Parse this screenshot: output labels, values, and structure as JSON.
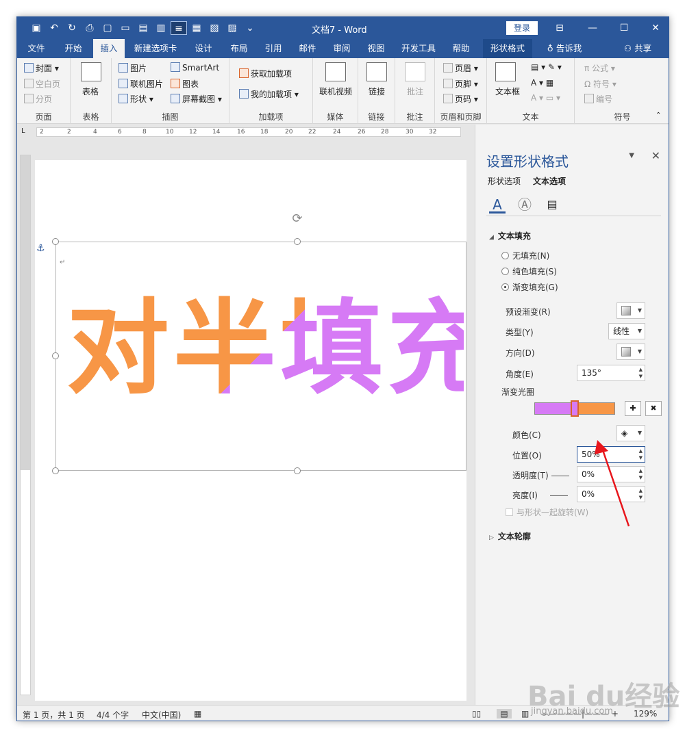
{
  "window": {
    "title": "文档7 - Word",
    "login_label": "登录",
    "controls": [
      "ribbon-display-icon",
      "minimize-icon",
      "maximize-icon",
      "close-icon"
    ]
  },
  "tabs": [
    {
      "label": "文件"
    },
    {
      "label": "开始"
    },
    {
      "label": "插入"
    },
    {
      "label": "新建选项卡"
    },
    {
      "label": "设计"
    },
    {
      "label": "布局"
    },
    {
      "label": "引用"
    },
    {
      "label": "邮件"
    },
    {
      "label": "审阅"
    },
    {
      "label": "视图"
    },
    {
      "label": "开发工具"
    },
    {
      "label": "帮助"
    },
    {
      "label": "形状格式"
    },
    {
      "label": "告诉我"
    },
    {
      "label": "共享"
    }
  ],
  "ribbon": {
    "pages": {
      "label": "页面",
      "cover": "封面",
      "blank": "空白页",
      "break": "分页"
    },
    "table": {
      "label": "表格",
      "btn": "表格"
    },
    "illustrations": {
      "label": "插图",
      "picture": "图片",
      "online_picture": "联机图片",
      "shapes": "形状",
      "smartart": "SmartArt",
      "chart": "图表",
      "screenshot": "屏幕截图"
    },
    "addins": {
      "label": "加载项",
      "get": "获取加载项",
      "mine": "我的加载项"
    },
    "media": {
      "label": "媒体",
      "video": "联机视频"
    },
    "links": {
      "label": "链接",
      "link": "链接"
    },
    "comments": {
      "label": "批注",
      "comment": "批注"
    },
    "header_footer": {
      "label": "页眉和页脚",
      "header": "页眉",
      "footer": "页脚",
      "page_number": "页码"
    },
    "text": {
      "label": "文本",
      "textbox": "文本框"
    },
    "symbols": {
      "label": "符号",
      "equation": "公式",
      "symbol": "符号",
      "number": "编号"
    }
  },
  "ruler": {
    "h_ticks": [
      "2",
      "2",
      "4",
      "6",
      "8",
      "10",
      "12",
      "14",
      "16",
      "18",
      "20",
      "22",
      "24",
      "26",
      "28",
      "30",
      "32"
    ]
  },
  "document": {
    "art_text": "对半填充"
  },
  "pane": {
    "title": "设置形状格式",
    "tab_shape": "形状选项",
    "tab_text": "文本选项",
    "section_fill": "文本填充",
    "radio_none": "无填充(N)",
    "radio_solid": "纯色填充(S)",
    "radio_gradient": "渐变填充(G)",
    "preset_label": "预设渐变(R)",
    "type_label": "类型(Y)",
    "type_value": "线性",
    "direction_label": "方向(D)",
    "angle_label": "角度(E)",
    "angle_value": "135°",
    "stops_label": "渐变光圈",
    "color_label": "颜色(C)",
    "position_label": "位置(O)",
    "position_value": "50%",
    "transparency_label": "透明度(T)",
    "transparency_value": "0%",
    "brightness_label": "亮度(I)",
    "brightness_value": "0%",
    "rotate_label": "与形状一起旋转(W)",
    "section_outline": "文本轮廓"
  },
  "gradient": {
    "left_color": "#d67af5",
    "right_color": "#f79646",
    "stop_position": 0.5
  },
  "status": {
    "page": "第 1 页，共 1 页",
    "words": "4/4 个字",
    "lang": "中文(中国)",
    "zoom": "129%"
  },
  "watermark": {
    "brand": "Bai du经验",
    "url": "jingyan.baidu.com"
  }
}
